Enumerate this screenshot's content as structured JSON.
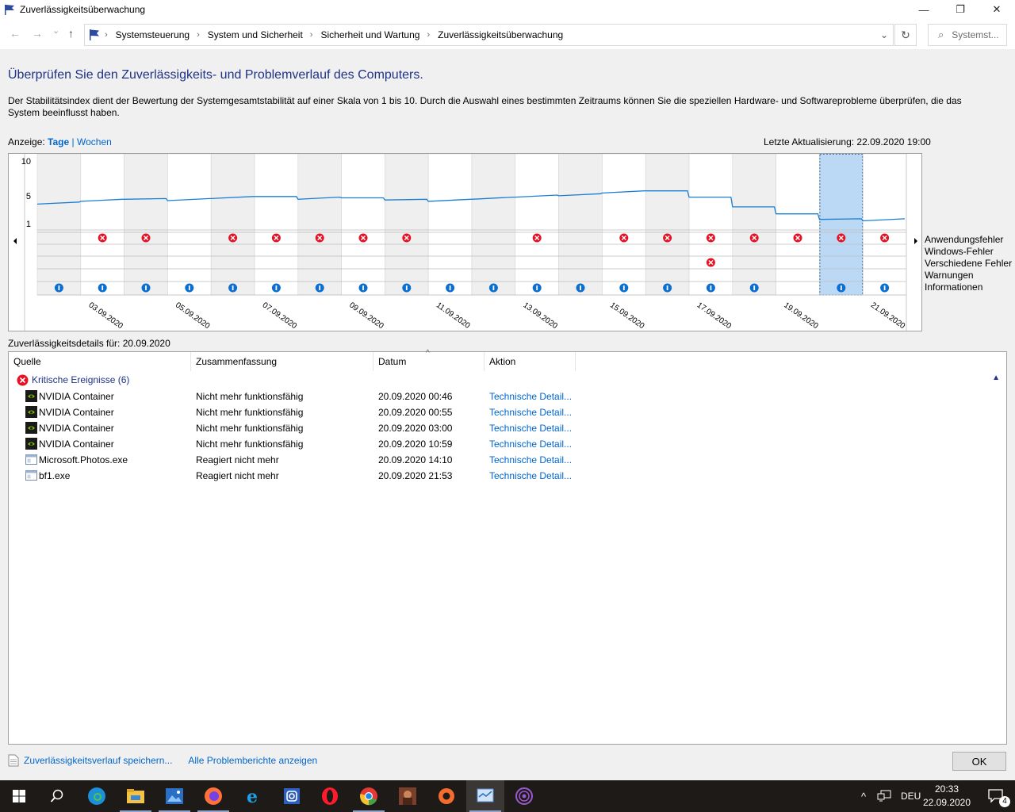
{
  "window": {
    "title": "Zuverlässigkeitsüberwachung",
    "minimize": "—",
    "maximize": "❐",
    "close": "✕"
  },
  "navigation": {
    "back": "←",
    "forward": "→",
    "recent": "⌄",
    "up": "↑",
    "breadcrumbs": [
      "Systemsteuerung",
      "System und Sicherheit",
      "Sicherheit und Wartung",
      "Zuverlässigkeitsüberwachung"
    ],
    "search_placeholder": "Systemst..."
  },
  "page": {
    "title": "Überprüfen Sie den Zuverlässigkeits- und Problemverlauf des Computers.",
    "description": "Der Stabilitätsindex dient der Bewertung der Systemgesamtstabilität auf einer Skala von 1 bis 10. Durch die Auswahl eines bestimmten Zeitraums können Sie die speziellen Hardware- und Softwareprobleme überprüfen, die das System beeinflusst haben.",
    "view_label": "Anzeige:",
    "view_days": "Tage",
    "view_separator": "|",
    "view_weeks": "Wochen",
    "last_update": "Letzte Aktualisierung: 22.09.2020 19:00"
  },
  "chart_data": {
    "type": "line",
    "y_ticks": [
      "10",
      "5",
      "1"
    ],
    "ylim": [
      1,
      10
    ],
    "dates": [
      "02.09.2020",
      "03.09.2020",
      "04.09.2020",
      "05.09.2020",
      "06.09.2020",
      "07.09.2020",
      "08.09.2020",
      "09.09.2020",
      "10.09.2020",
      "11.09.2020",
      "12.09.2020",
      "13.09.2020",
      "14.09.2020",
      "15.09.2020",
      "16.09.2020",
      "17.09.2020",
      "18.09.2020",
      "19.09.2020",
      "20.09.2020",
      "21.09.2020"
    ],
    "x_tick_labels": [
      "03.09.2020",
      "05.09.2020",
      "07.09.2020",
      "09.09.2020",
      "11.09.2020",
      "13.09.2020",
      "15.09.2020",
      "17.09.2020",
      "19.09.2020",
      "21.09.2020"
    ],
    "stability_index": [
      3.8,
      4.2,
      4.5,
      4.3,
      4.6,
      4.9,
      4.5,
      4.7,
      4.4,
      4.2,
      4.5,
      4.8,
      5.0,
      5.4,
      5.7,
      4.8,
      3.4,
      2.4,
      1.6,
      1.4
    ],
    "selected_date": "20.09.2020",
    "legend_position": "right",
    "rows": [
      "Anwendungsfehler",
      "Windows-Fehler",
      "Verschiedene Fehler",
      "Warnungen",
      "Informationen"
    ],
    "app_errors": [
      0,
      1,
      1,
      0,
      1,
      1,
      1,
      1,
      1,
      0,
      0,
      1,
      0,
      1,
      1,
      1,
      1,
      1,
      1,
      1
    ],
    "windows_errors": [
      0,
      0,
      0,
      0,
      0,
      0,
      0,
      0,
      0,
      0,
      0,
      0,
      0,
      0,
      0,
      0,
      0,
      0,
      0,
      0
    ],
    "misc_errors": [
      0,
      0,
      0,
      0,
      0,
      0,
      0,
      0,
      0,
      0,
      0,
      0,
      0,
      0,
      0,
      1,
      0,
      0,
      0,
      0
    ],
    "warnings": [
      0,
      0,
      0,
      0,
      0,
      0,
      0,
      0,
      0,
      0,
      0,
      0,
      0,
      0,
      0,
      0,
      0,
      0,
      0,
      0
    ],
    "informations": [
      1,
      1,
      1,
      1,
      1,
      1,
      1,
      1,
      1,
      1,
      1,
      1,
      1,
      1,
      1,
      1,
      1,
      0,
      1,
      1
    ]
  },
  "details": {
    "label": "Zuverlässigkeitsdetails für: 20.09.2020",
    "columns": [
      "Quelle",
      "Zusammenfassung",
      "Datum",
      "Aktion"
    ],
    "group_label": "Kritische Ereignisse (6)",
    "rows": [
      {
        "source": "NVIDIA Container",
        "summary": "Nicht mehr funktionsfähig",
        "date": "20.09.2020 00:46",
        "action": "Technische Detail...",
        "icon": "nvidia-icon"
      },
      {
        "source": "NVIDIA Container",
        "summary": "Nicht mehr funktionsfähig",
        "date": "20.09.2020 00:55",
        "action": "Technische Detail...",
        "icon": "nvidia-icon"
      },
      {
        "source": "NVIDIA Container",
        "summary": "Nicht mehr funktionsfähig",
        "date": "20.09.2020 03:00",
        "action": "Technische Detail...",
        "icon": "nvidia-icon"
      },
      {
        "source": "NVIDIA Container",
        "summary": "Nicht mehr funktionsfähig",
        "date": "20.09.2020 10:59",
        "action": "Technische Detail...",
        "icon": "nvidia-icon"
      },
      {
        "source": "Microsoft.Photos.exe",
        "summary": "Reagiert nicht mehr",
        "date": "20.09.2020 14:10",
        "action": "Technische Detail...",
        "icon": "application-window-icon"
      },
      {
        "source": "bf1.exe",
        "summary": "Reagiert nicht mehr",
        "date": "20.09.2020 21:53",
        "action": "Technische Detail...",
        "icon": "application-window-icon"
      }
    ]
  },
  "footer": {
    "save_history": "Zuverlässigkeitsverlauf speichern...",
    "all_reports": "Alle Problemberichte anzeigen",
    "ok": "OK"
  },
  "taskbar": {
    "apps": [
      "start-button",
      "search-icon",
      "edge-icon",
      "file-explorer-icon",
      "photos-icon",
      "firefox-icon",
      "internet-explorer-icon",
      "instagram-icon",
      "opera-icon",
      "chrome-icon",
      "game-icon",
      "origin-icon",
      "reliability-monitor-icon",
      "tor-icon"
    ],
    "language": "DEU",
    "time": "20:33",
    "date": "22.09.2020",
    "notifications": "4"
  },
  "colors": {
    "accent_blue": "#0066cc",
    "title_blue": "#1e3287",
    "line_blue": "#1a7fd4",
    "error_red": "#e81123",
    "info_blue": "#0a6fd1",
    "selection": "#bbd9f4"
  }
}
